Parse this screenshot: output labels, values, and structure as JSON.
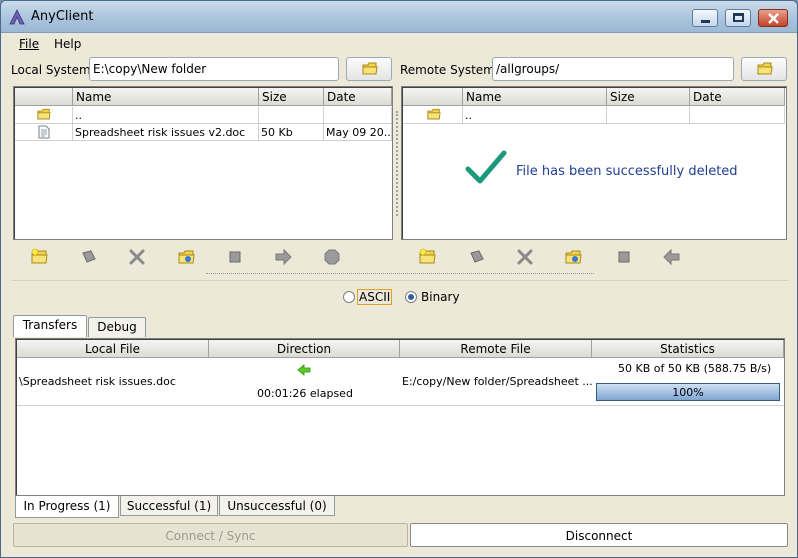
{
  "window": {
    "title": "AnyClient"
  },
  "menu": {
    "file": "File",
    "help": "Help"
  },
  "local": {
    "label": "Local System",
    "path": "E:\\copy\\New folder",
    "columns": [
      "Name",
      "Size",
      "Date"
    ],
    "rows": [
      {
        "name": "..",
        "size": "",
        "date": ""
      },
      {
        "name": "Spreadsheet risk issues v2.doc",
        "size": "50 Kb",
        "date": "May 09 20..."
      }
    ]
  },
  "remote": {
    "label": "Remote System",
    "path": "/allgroups/",
    "columns": [
      "Name",
      "Size",
      "Date"
    ],
    "rows": [
      {
        "name": "..",
        "size": "",
        "date": ""
      }
    ],
    "message": "File has been successfully deleted"
  },
  "mode": {
    "ascii": "ASCII",
    "binary": "Binary",
    "selected": "binary"
  },
  "tabs": {
    "transfers": "Transfers",
    "debug": "Debug"
  },
  "transfers": {
    "columns": [
      "Local File",
      "Direction",
      "Remote File",
      "Statistics"
    ],
    "row": {
      "local_file": "\\Spreadsheet risk issues.doc",
      "elapsed": "00:01:26 elapsed",
      "remote_file": "E:/copy/New folder/Spreadsheet ...",
      "stats": "50 KB of 50 KB (588.75 B/s)",
      "progress_label": "100%",
      "progress": 1.0
    }
  },
  "bottom_tabs": {
    "in_progress": "In Progress (1)",
    "successful": "Successful (1)",
    "unsuccessful": "Unsuccessful (0)"
  },
  "buttons": {
    "connect": "Connect / Sync",
    "disconnect": "Disconnect"
  },
  "colors": {
    "accent": "#1a9a7a",
    "message": "#1f3f8f",
    "progress": "#7fa6d3"
  }
}
